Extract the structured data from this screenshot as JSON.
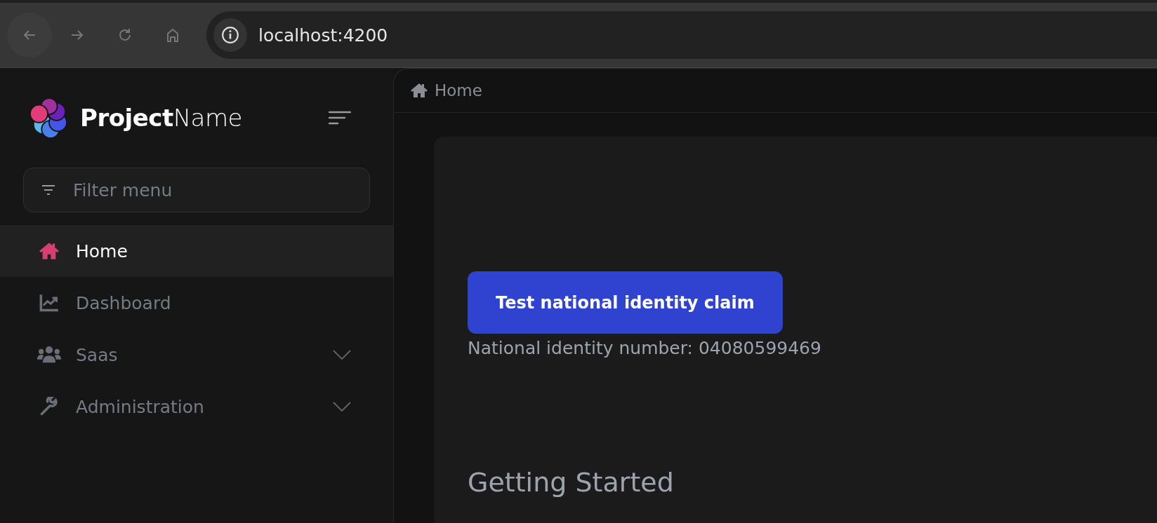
{
  "browser": {
    "url": "localhost:4200"
  },
  "sidebar": {
    "brand": "**Project**Name",
    "filter": {
      "placeholder": "Filter menu"
    },
    "items": [
      {
        "label": "Home",
        "selected": true,
        "has_children": false
      },
      {
        "label": "Dashboard",
        "selected": false,
        "has_children": false
      },
      {
        "label": "Saas",
        "selected": false,
        "has_children": true
      },
      {
        "label": "Administration",
        "selected": false,
        "has_children": true
      }
    ]
  },
  "breadcrumb": [
    "Home"
  ],
  "content": {
    "button": "Test national identity claim",
    "identity_text": "National identity number: 04080599469",
    "heading": "Getting Started"
  }
}
